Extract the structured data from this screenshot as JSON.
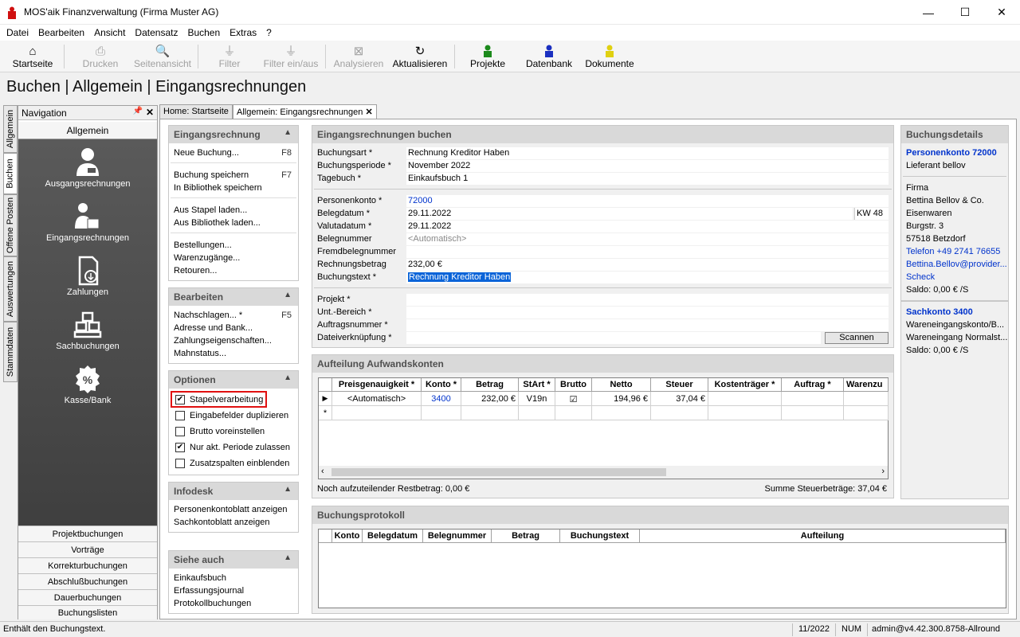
{
  "window": {
    "title": "MOS'aik Finanzverwaltung (Firma Muster AG)",
    "minimize": "—",
    "maximize": "☐",
    "close": "✕"
  },
  "menu": [
    "Datei",
    "Bearbeiten",
    "Ansicht",
    "Datensatz",
    "Buchen",
    "Extras",
    "?"
  ],
  "toolbar": {
    "startseite": "Startseite",
    "drucken": "Drucken",
    "seitenansicht": "Seitenansicht",
    "filter": "Filter",
    "filter_ein_aus": "Filter ein/aus",
    "analysieren": "Analysieren",
    "aktualisieren": "Aktualisieren",
    "projekte": "Projekte",
    "datenbank": "Datenbank",
    "dokumente": "Dokumente"
  },
  "page_title": "Buchen | Allgemein | Eingangsrechnungen",
  "vertical_tabs": [
    "Allgemein",
    "Buchen",
    "Offene Posten",
    "Auswertungen",
    "Stammdaten"
  ],
  "navigation": {
    "header": "Navigation",
    "pin": "📌",
    "close": "✕",
    "group": "Allgemein",
    "items": [
      "Ausgangsrechnungen",
      "Eingangsrechnungen",
      "Zahlungen",
      "Sachbuchungen",
      "Kasse/Bank"
    ],
    "list": [
      "Projektbuchungen",
      "Vorträge",
      "Korrekturbuchungen",
      "Abschlußbuchungen",
      "Dauerbuchungen",
      "Buchungslisten"
    ]
  },
  "doc_tabs": {
    "home": "Home: Startseite",
    "active": "Allgemein: Eingangsrechnungen",
    "close": "✕"
  },
  "tasks": {
    "eingangsrechnung": {
      "title": "Eingangsrechnung",
      "neue_buchung": "Neue Buchung...",
      "key_f8": "F8",
      "speichern": "Buchung speichern",
      "key_f7": "F7",
      "bibliothek_speichern": "In Bibliothek speichern",
      "stapel_laden": "Aus Stapel laden...",
      "bibliothek_laden": "Aus Bibliothek laden...",
      "bestellungen": "Bestellungen...",
      "warenzugaenge": "Warenzugänge...",
      "retouren": "Retouren..."
    },
    "bearbeiten": {
      "title": "Bearbeiten",
      "nachschlagen": "Nachschlagen... *",
      "key_f5": "F5",
      "adresse": "Adresse und Bank...",
      "zahlung": "Zahlungseigenschaften...",
      "mahnstatus": "Mahnstatus..."
    },
    "optionen": {
      "title": "Optionen",
      "items": [
        {
          "label": "Stapelverarbeitung",
          "checked": "✔"
        },
        {
          "label": "Eingabefelder duplizieren",
          "checked": ""
        },
        {
          "label": "Brutto voreinstellen",
          "checked": ""
        },
        {
          "label": "Nur akt. Periode zulassen",
          "checked": "✔"
        },
        {
          "label": "Zusatzspalten einblenden",
          "checked": ""
        }
      ]
    },
    "infodesk": {
      "title": "Infodesk",
      "personenkonto": "Personenkontoblatt anzeigen",
      "sachkonto": "Sachkontoblatt anzeigen"
    },
    "siehe_auch": {
      "title": "Siehe auch",
      "einkaufsbuch": "Einkaufsbuch",
      "erfassungsjournal": "Erfassungsjournal",
      "protokoll": "Protokollbuchungen"
    }
  },
  "form": {
    "title": "Eingangsrechnungen buchen",
    "buchungsart_label": "Buchungsart *",
    "buchungsart": "Rechnung Kreditor Haben",
    "periode_label": "Buchungsperiode *",
    "periode": "November 2022",
    "tagebuch_label": "Tagebuch *",
    "tagebuch": "Einkaufsbuch 1",
    "personenkonto_label": "Personenkonto *",
    "personenkonto": "72000",
    "belegdatum_label": "Belegdatum *",
    "belegdatum": "29.11.2022",
    "kw": "KW 48",
    "valutadatum_label": "Valutadatum *",
    "valutadatum": "29.11.2022",
    "belegnummer_label": "Belegnummer",
    "belegnummer_placeholder": "<Automatisch>",
    "fremdbeleg_label": "Fremdbelegnummer",
    "fremdbeleg": "",
    "betrag_label": "Rechnungsbetrag",
    "betrag": "232,00 €",
    "buchungstext_label": "Buchungstext *",
    "buchungstext": "Rechnung Kreditor Haben",
    "projekt_label": "Projekt *",
    "unt_label": "Unt.-Bereich *",
    "auftrag_label": "Auftragsnummer *",
    "datei_label": "Dateiverknüpfung *",
    "scannen": "Scannen"
  },
  "aufteilung": {
    "title": "Aufteilung Aufwandskonten",
    "columns": [
      "Preisgenauigkeit *",
      "Konto *",
      "Betrag",
      "StArt *",
      "Brutto",
      "Netto",
      "Steuer",
      "Kostenträger *",
      "Auftrag *",
      "Warenzu"
    ],
    "row": {
      "preis": "<Automatisch>",
      "konto": "3400",
      "betrag": "232,00 €",
      "start": "V19n",
      "brutto": "☑",
      "netto": "194,96 €",
      "steuer": "37,04 €"
    },
    "row_marker": "▶",
    "new_marker": "*",
    "rest": "Noch aufzuteilender Restbetrag: 0,00 €",
    "summe": "Summe Steuerbeträge: 37,04 €"
  },
  "protokoll": {
    "title": "Buchungsprotokoll",
    "columns": [
      "Konto",
      "Belegdatum",
      "Belegnummer",
      "Betrag",
      "Buchungstext",
      "Aufteilung"
    ]
  },
  "details": {
    "title": "Buchungsdetails",
    "personenkonto": "Personenkonto 72000",
    "lieferant": "Lieferant bellov",
    "firma": "Firma",
    "name": "Bettina Bellov & Co.",
    "branche": "Eisenwaren",
    "strasse": "Burgstr. 3",
    "ort": "57518 Betzdorf",
    "telefon": "Telefon +49 2741 76655",
    "email": "Bettina.Bellov@provider...",
    "zahlung": "Scheck",
    "saldo1": "Saldo: 0,00 € /S",
    "sachkonto": "Sachkonto 3400",
    "sk_name": "Wareneingangskonto/B...",
    "sk_desc": "Wareneingang Normalst...",
    "saldo2": "Saldo: 0,00 € /S"
  },
  "status": {
    "text": "Enthält den Buchungstext.",
    "period": "11/2022",
    "num": "NUM",
    "user": "admin@v4.42.300.8758-Allround"
  },
  "colors": {
    "highlight": "#0a64d8",
    "link": "#0033cc",
    "red_frame": "#e01010"
  }
}
